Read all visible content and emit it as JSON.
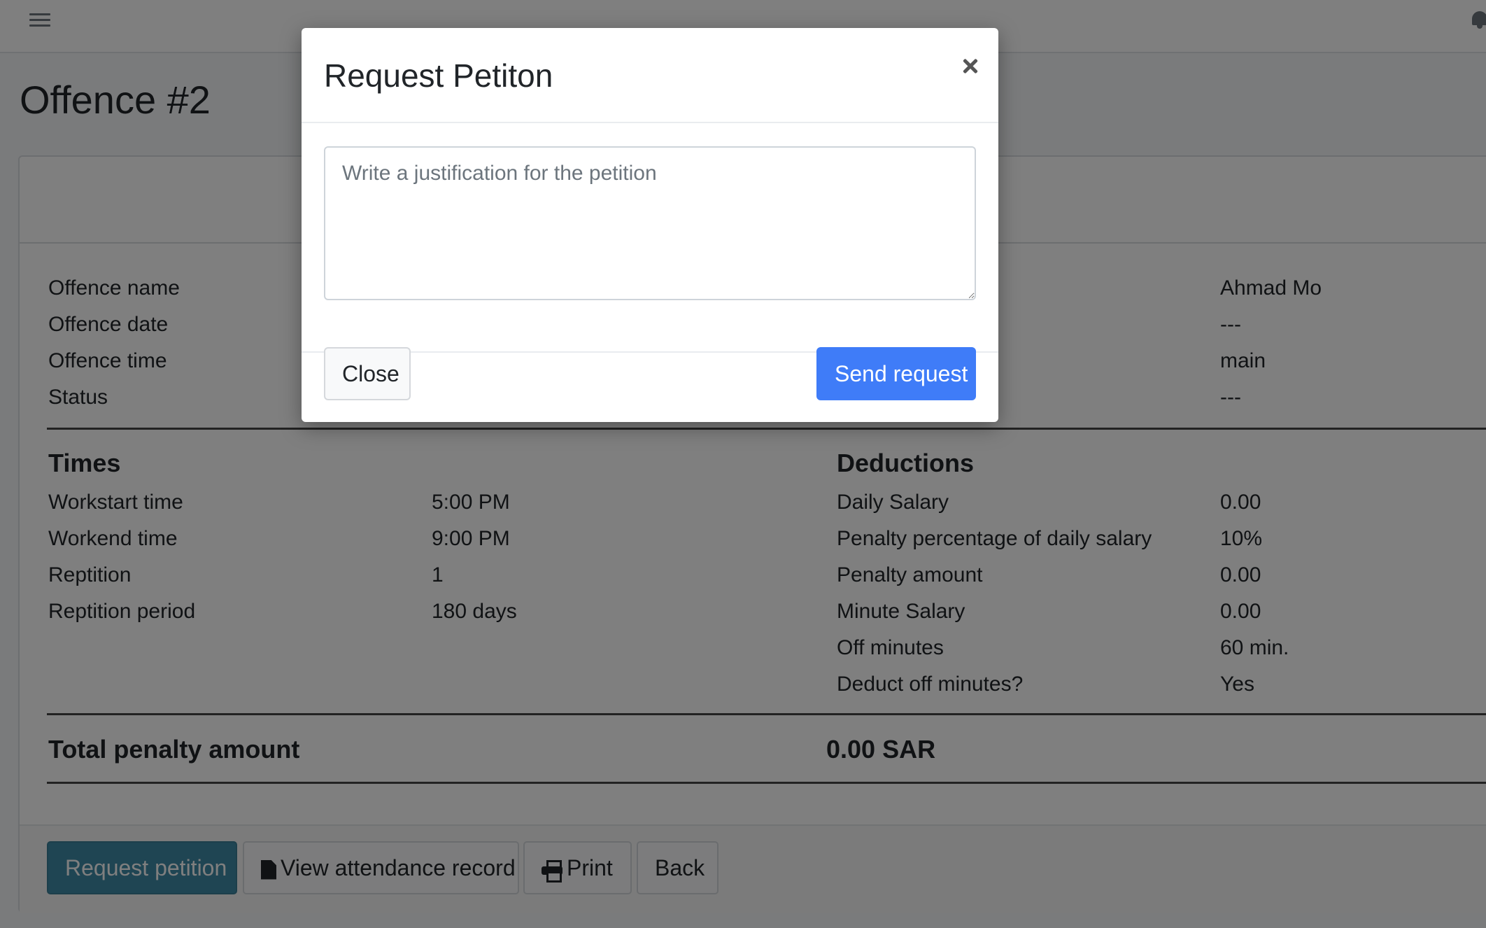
{
  "page": {
    "title": "Offence #2"
  },
  "details": {
    "left": [
      {
        "label": "Offence name"
      },
      {
        "label": "Offence date"
      },
      {
        "label": "Offence time"
      },
      {
        "label": "Status"
      }
    ],
    "right_values": [
      "Ahmad Mo",
      "---",
      "main",
      "---"
    ]
  },
  "times": {
    "heading": "Times",
    "rows": [
      {
        "label": "Workstart time",
        "value": "5:00 PM"
      },
      {
        "label": "Workend time",
        "value": "9:00 PM"
      },
      {
        "label": "Reptition",
        "value": "1"
      },
      {
        "label": "Reptition period",
        "value": "180 days"
      }
    ]
  },
  "deductions": {
    "heading": "Deductions",
    "rows": [
      {
        "label": "Daily Salary",
        "value": "0.00"
      },
      {
        "label": "Penalty percentage of daily salary",
        "value": "10%"
      },
      {
        "label": "Penalty amount",
        "value": "0.00"
      },
      {
        "label": "Minute Salary",
        "value": "0.00"
      },
      {
        "label": "Off minutes",
        "value": "60 min."
      },
      {
        "label": "Deduct off minutes?",
        "value": "Yes"
      }
    ]
  },
  "total": {
    "label": "Total penalty amount",
    "value": "0.00 SAR"
  },
  "actions": {
    "request_petition": "Request petition",
    "view_attendance": "View attendance record",
    "print": "Print",
    "back": "Back"
  },
  "modal": {
    "title": "Request Petiton",
    "textarea_placeholder": "Write a justification for the petition",
    "close_label": "Close",
    "send_label": "Send request"
  },
  "icons": {
    "menu": "hamburger-menu-icon",
    "notifications": "bell-icon",
    "file": "file-icon",
    "print": "printer-icon",
    "close": "close-icon"
  },
  "colors": {
    "primary": "#3f7cf8",
    "teal_button": "#3f8ba6",
    "overlay": "rgba(0,0,0,0.5)"
  }
}
